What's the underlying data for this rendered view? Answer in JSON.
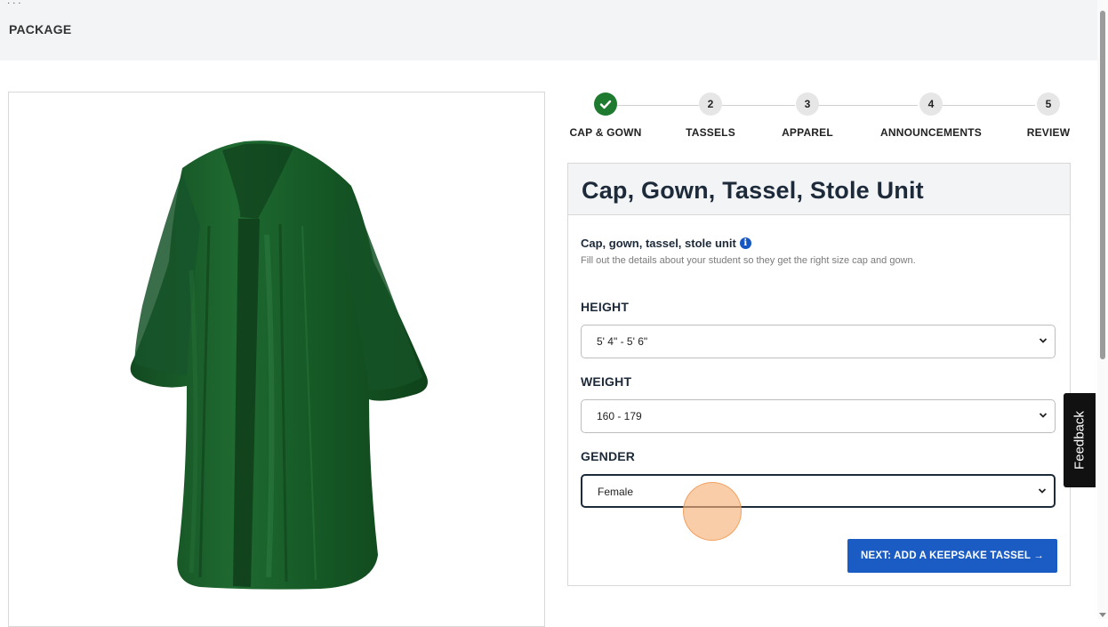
{
  "header": {
    "cut_text": "·   ·  ·",
    "section_label": "PACKAGE"
  },
  "stepper": {
    "steps": [
      {
        "number": "✓",
        "label": "CAP & GOWN",
        "done": true
      },
      {
        "number": "2",
        "label": "TASSELS",
        "done": false
      },
      {
        "number": "3",
        "label": "APPAREL",
        "done": false
      },
      {
        "number": "4",
        "label": "ANNOUNCEMENTS",
        "done": false
      },
      {
        "number": "5",
        "label": "REVIEW",
        "done": false
      }
    ]
  },
  "card": {
    "title": "Cap, Gown, Tassel, Stole Unit",
    "subtitle": "Cap, gown, tassel, stole unit",
    "info_icon": "i",
    "help_text": "Fill out the details about your student so they get the right size cap and gown.",
    "fields": {
      "height": {
        "label": "HEIGHT",
        "value": "5' 4\" - 5' 6\""
      },
      "weight": {
        "label": "WEIGHT",
        "value": "160 - 179"
      },
      "gender": {
        "label": "GENDER",
        "value": "Female"
      }
    },
    "next_button": "NEXT: ADD A KEEPSAKE TASSEL →"
  },
  "feedback": {
    "label": "Feedback"
  },
  "colors": {
    "gown": "#1c5e2c",
    "accent_blue": "#1a5bc4",
    "step_done": "#1e7a2e"
  },
  "icons": {
    "step_done": "check-icon",
    "select_arrow": "chevron-down-icon",
    "info": "info-icon"
  }
}
